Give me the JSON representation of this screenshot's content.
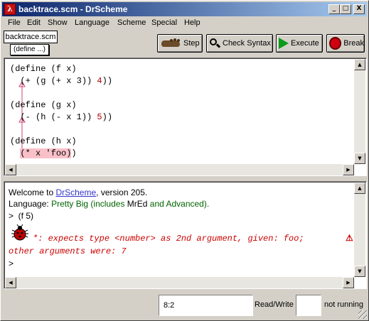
{
  "window": {
    "title": "backtrace.scm - DrScheme",
    "title_icon": "lambda-icon",
    "minimize_glyph": "_",
    "maximize_glyph": "□",
    "close_glyph": "X"
  },
  "menu": [
    "File",
    "Edit",
    "Show",
    "Language",
    "Scheme",
    "Special",
    "Help"
  ],
  "tab": {
    "label": "backtrace.scm"
  },
  "define_popup": {
    "label": "(define ...)"
  },
  "toolbar": {
    "step": {
      "label": "Step",
      "icon": "footprint-icon"
    },
    "check_syntax": {
      "label": "Check Syntax",
      "icon": "magnifier-icon"
    },
    "execute": {
      "label": "Execute",
      "icon": "play-icon"
    },
    "break": {
      "label": "Break",
      "icon": "stop-icon"
    }
  },
  "definitions": {
    "lines": [
      "(define (f x)",
      "  (+ (g (+ x 3)) 4))",
      "",
      "(define (g x)",
      "  (- (h (- x 1)) 5))",
      "",
      "(define (h x)",
      "  (* x 'foo))"
    ],
    "num_4": "4",
    "num_5": "5",
    "error_expr": "(* x 'foo)"
  },
  "interactions": {
    "welcome_prefix": "Welcome to ",
    "welcome_link": "DrScheme",
    "welcome_suffix": ", version 205.",
    "language_prefix": "Language: ",
    "language_name": "Pretty Big (includes ",
    "language_mred": "MrEd",
    "language_and": " and ",
    "language_advanced": "Advanced).",
    "prompt_input": ">  (f 5)",
    "error_line1": "*: expects type <number> as 2nd argument, given: foo;",
    "error_line2": "other arguments were: 7",
    "error_glyph": "⚠",
    "prompt_empty": ">"
  },
  "status": {
    "position": "8:2",
    "read_write": "Read/Write",
    "running": "not running"
  },
  "colors": {
    "title_bar_start": "#0a246a",
    "title_bar_end": "#a6caf0",
    "error_text": "#cc0000",
    "highlight": "#f9c0c8",
    "number": "#b00000",
    "link": "#3333cc",
    "language_text": "#006400"
  }
}
